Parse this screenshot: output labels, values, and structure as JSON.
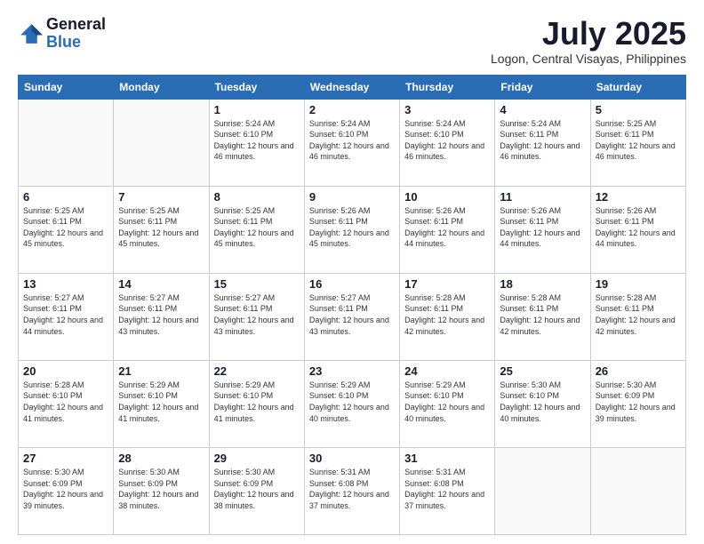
{
  "header": {
    "logo_general": "General",
    "logo_blue": "Blue",
    "month_title": "July 2025",
    "location": "Logon, Central Visayas, Philippines"
  },
  "days_of_week": [
    "Sunday",
    "Monday",
    "Tuesday",
    "Wednesday",
    "Thursday",
    "Friday",
    "Saturday"
  ],
  "weeks": [
    [
      {
        "day": "",
        "info": ""
      },
      {
        "day": "",
        "info": ""
      },
      {
        "day": "1",
        "info": "Sunrise: 5:24 AM\nSunset: 6:10 PM\nDaylight: 12 hours and 46 minutes."
      },
      {
        "day": "2",
        "info": "Sunrise: 5:24 AM\nSunset: 6:10 PM\nDaylight: 12 hours and 46 minutes."
      },
      {
        "day": "3",
        "info": "Sunrise: 5:24 AM\nSunset: 6:10 PM\nDaylight: 12 hours and 46 minutes."
      },
      {
        "day": "4",
        "info": "Sunrise: 5:24 AM\nSunset: 6:11 PM\nDaylight: 12 hours and 46 minutes."
      },
      {
        "day": "5",
        "info": "Sunrise: 5:25 AM\nSunset: 6:11 PM\nDaylight: 12 hours and 46 minutes."
      }
    ],
    [
      {
        "day": "6",
        "info": "Sunrise: 5:25 AM\nSunset: 6:11 PM\nDaylight: 12 hours and 45 minutes."
      },
      {
        "day": "7",
        "info": "Sunrise: 5:25 AM\nSunset: 6:11 PM\nDaylight: 12 hours and 45 minutes."
      },
      {
        "day": "8",
        "info": "Sunrise: 5:25 AM\nSunset: 6:11 PM\nDaylight: 12 hours and 45 minutes."
      },
      {
        "day": "9",
        "info": "Sunrise: 5:26 AM\nSunset: 6:11 PM\nDaylight: 12 hours and 45 minutes."
      },
      {
        "day": "10",
        "info": "Sunrise: 5:26 AM\nSunset: 6:11 PM\nDaylight: 12 hours and 44 minutes."
      },
      {
        "day": "11",
        "info": "Sunrise: 5:26 AM\nSunset: 6:11 PM\nDaylight: 12 hours and 44 minutes."
      },
      {
        "day": "12",
        "info": "Sunrise: 5:26 AM\nSunset: 6:11 PM\nDaylight: 12 hours and 44 minutes."
      }
    ],
    [
      {
        "day": "13",
        "info": "Sunrise: 5:27 AM\nSunset: 6:11 PM\nDaylight: 12 hours and 44 minutes."
      },
      {
        "day": "14",
        "info": "Sunrise: 5:27 AM\nSunset: 6:11 PM\nDaylight: 12 hours and 43 minutes."
      },
      {
        "day": "15",
        "info": "Sunrise: 5:27 AM\nSunset: 6:11 PM\nDaylight: 12 hours and 43 minutes."
      },
      {
        "day": "16",
        "info": "Sunrise: 5:27 AM\nSunset: 6:11 PM\nDaylight: 12 hours and 43 minutes."
      },
      {
        "day": "17",
        "info": "Sunrise: 5:28 AM\nSunset: 6:11 PM\nDaylight: 12 hours and 42 minutes."
      },
      {
        "day": "18",
        "info": "Sunrise: 5:28 AM\nSunset: 6:11 PM\nDaylight: 12 hours and 42 minutes."
      },
      {
        "day": "19",
        "info": "Sunrise: 5:28 AM\nSunset: 6:11 PM\nDaylight: 12 hours and 42 minutes."
      }
    ],
    [
      {
        "day": "20",
        "info": "Sunrise: 5:28 AM\nSunset: 6:10 PM\nDaylight: 12 hours and 41 minutes."
      },
      {
        "day": "21",
        "info": "Sunrise: 5:29 AM\nSunset: 6:10 PM\nDaylight: 12 hours and 41 minutes."
      },
      {
        "day": "22",
        "info": "Sunrise: 5:29 AM\nSunset: 6:10 PM\nDaylight: 12 hours and 41 minutes."
      },
      {
        "day": "23",
        "info": "Sunrise: 5:29 AM\nSunset: 6:10 PM\nDaylight: 12 hours and 40 minutes."
      },
      {
        "day": "24",
        "info": "Sunrise: 5:29 AM\nSunset: 6:10 PM\nDaylight: 12 hours and 40 minutes."
      },
      {
        "day": "25",
        "info": "Sunrise: 5:30 AM\nSunset: 6:10 PM\nDaylight: 12 hours and 40 minutes."
      },
      {
        "day": "26",
        "info": "Sunrise: 5:30 AM\nSunset: 6:09 PM\nDaylight: 12 hours and 39 minutes."
      }
    ],
    [
      {
        "day": "27",
        "info": "Sunrise: 5:30 AM\nSunset: 6:09 PM\nDaylight: 12 hours and 39 minutes."
      },
      {
        "day": "28",
        "info": "Sunrise: 5:30 AM\nSunset: 6:09 PM\nDaylight: 12 hours and 38 minutes."
      },
      {
        "day": "29",
        "info": "Sunrise: 5:30 AM\nSunset: 6:09 PM\nDaylight: 12 hours and 38 minutes."
      },
      {
        "day": "30",
        "info": "Sunrise: 5:31 AM\nSunset: 6:08 PM\nDaylight: 12 hours and 37 minutes."
      },
      {
        "day": "31",
        "info": "Sunrise: 5:31 AM\nSunset: 6:08 PM\nDaylight: 12 hours and 37 minutes."
      },
      {
        "day": "",
        "info": ""
      },
      {
        "day": "",
        "info": ""
      }
    ]
  ]
}
